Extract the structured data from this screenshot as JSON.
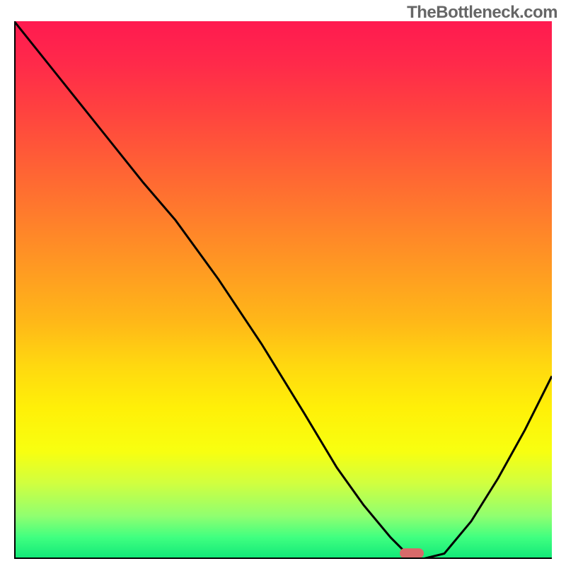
{
  "watermark": "TheBottleneck.com",
  "chart_data": {
    "type": "line",
    "title": "",
    "xlabel": "",
    "ylabel": "",
    "xlim": [
      0,
      100
    ],
    "ylim": [
      0,
      100
    ],
    "grid": false,
    "legend": false,
    "series": [
      {
        "name": "curve",
        "x": [
          0,
          8,
          16,
          24,
          30,
          38,
          46,
          54,
          60,
          65,
          70,
          73,
          76,
          80,
          85,
          90,
          95,
          100
        ],
        "values": [
          100,
          90,
          80,
          70,
          63,
          52,
          40,
          27,
          17,
          10,
          4,
          1,
          0,
          1,
          7,
          15,
          24,
          34
        ]
      }
    ],
    "marker": {
      "x": 74,
      "y": 1
    },
    "background": "vertical-gradient red-to-green"
  }
}
